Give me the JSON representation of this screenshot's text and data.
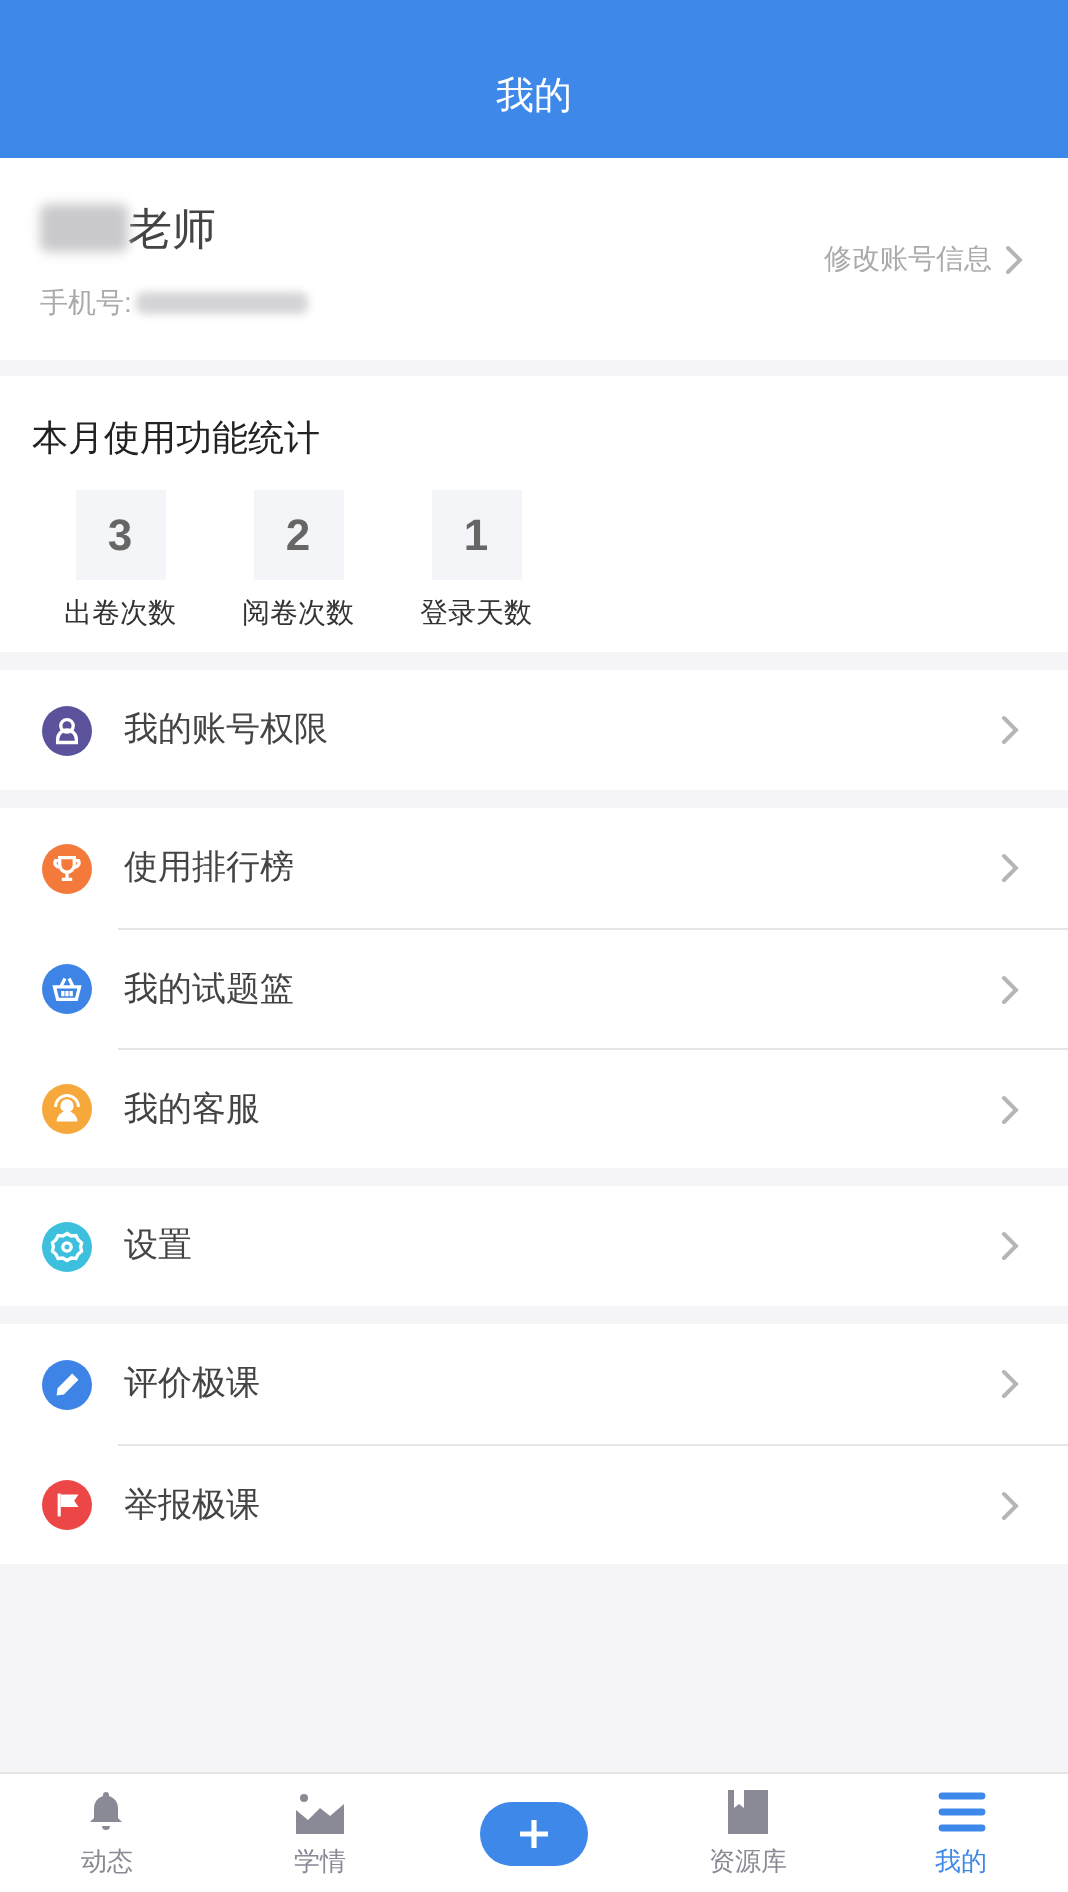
{
  "header": {
    "title": "我的"
  },
  "profile": {
    "name_suffix": "老师",
    "phone_label": "手机号:",
    "edit_link": "修改账号信息"
  },
  "stats": {
    "title": "本月使用功能统计",
    "items": [
      {
        "value": "3",
        "label": "出卷次数"
      },
      {
        "value": "2",
        "label": "阅卷次数"
      },
      {
        "value": "1",
        "label": "登录天数"
      }
    ]
  },
  "menu_groups": [
    [
      {
        "label": "我的账号权限",
        "color": "#5a539b"
      }
    ],
    [
      {
        "label": "使用排行榜",
        "color": "#f47a3c"
      },
      {
        "label": "我的试题篮",
        "color": "#3d84e6"
      },
      {
        "label": "我的客服",
        "color": "#f7a83a"
      }
    ],
    [
      {
        "label": "设置",
        "color": "#3cc0dd"
      }
    ],
    [
      {
        "label": "评价极课",
        "color": "#3d84e6"
      },
      {
        "label": "举报极课",
        "color": "#ec4646"
      }
    ]
  ],
  "tab_bar": [
    {
      "kind": "tab",
      "label": "动态",
      "selected": false
    },
    {
      "kind": "tab",
      "label": "学情",
      "selected": false
    },
    {
      "kind": "add",
      "selected": false
    },
    {
      "kind": "tab",
      "label": "资源库",
      "selected": false
    },
    {
      "kind": "tab",
      "label": "我的",
      "selected": true
    }
  ]
}
